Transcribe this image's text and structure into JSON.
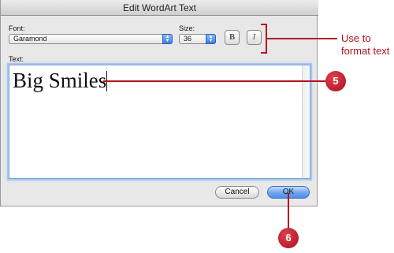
{
  "window": {
    "title": "Edit WordArt Text"
  },
  "font": {
    "label": "Font:",
    "value": "Garamond"
  },
  "size": {
    "label": "Size:",
    "value": "36"
  },
  "style_buttons": {
    "bold": "B",
    "italic": "I"
  },
  "text": {
    "label": "Text:",
    "value": "Big Smiles"
  },
  "buttons": {
    "cancel": "Cancel",
    "ok": "OK"
  },
  "callouts": {
    "format_text": "Use to\nformat text",
    "step_text_field": "5",
    "step_ok": "6"
  },
  "colors": {
    "callout_red": "#b4121f",
    "ok_blue": "#5f9bec",
    "focus_ring": "#a9c8ee"
  }
}
